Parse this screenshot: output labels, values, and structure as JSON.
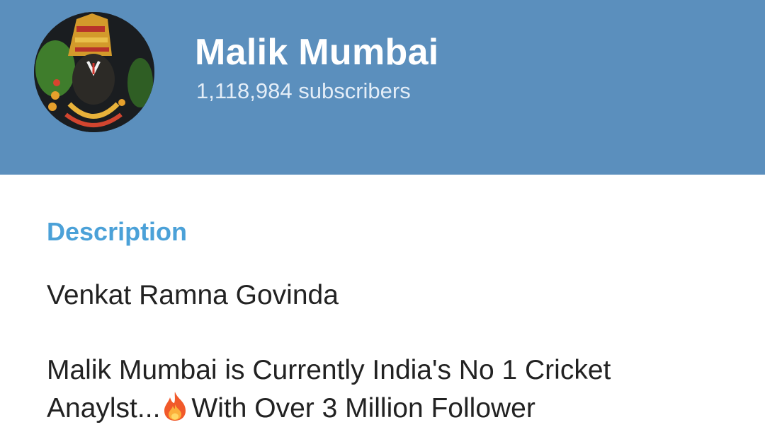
{
  "channel": {
    "name": "Malik Mumbai",
    "subscribers": "1,118,984 subscribers",
    "avatar_icon": "deity-portrait-icon"
  },
  "description": {
    "heading": "Description",
    "line1": "Venkat Ramna Govinda",
    "line2_part1": "Malik Mumbai is Currently India's No 1 Cricket",
    "line3_part1": "Anaylst...",
    "line3_part2": "With Over 3 Million Follower",
    "emoji_icon": "fire-emoji-icon"
  },
  "colors": {
    "header_bg": "#5b8fbd",
    "accent": "#4ba1d8",
    "text": "#222222"
  }
}
